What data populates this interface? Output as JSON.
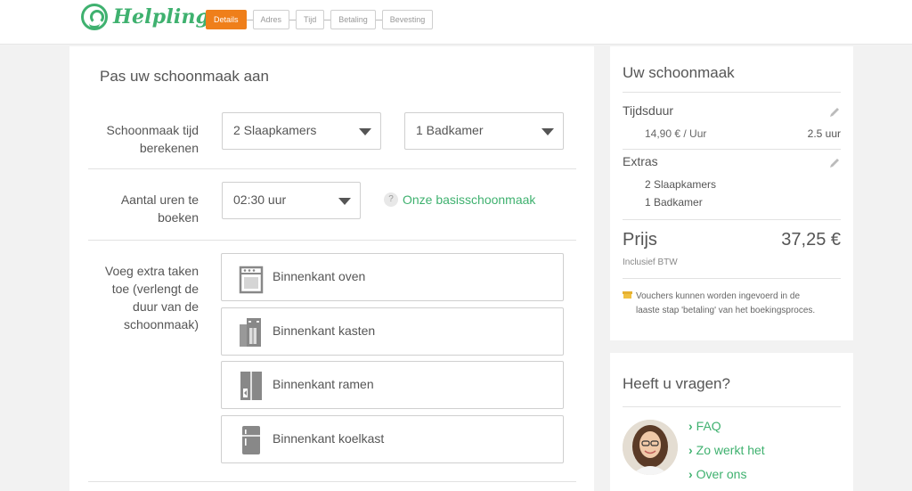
{
  "header": {
    "logo_text": "Helpling",
    "steps": [
      {
        "label": "Details",
        "active": true
      },
      {
        "label": "Adres",
        "active": false
      },
      {
        "label": "Tijd",
        "active": false
      },
      {
        "label": "Betaling",
        "active": false
      },
      {
        "label": "Bevesting",
        "active": false
      }
    ]
  },
  "main": {
    "title": "Pas uw schoonmaak aan",
    "calc_label_line1": "Schoonmaak tijd",
    "calc_label_line2": "berekenen",
    "bedrooms_select": "2 Slaapkamers",
    "bathrooms_select": "1 Badkamer",
    "hours_label_line1": "Aantal uren te",
    "hours_label_line2": "boeken",
    "hours_select": "02:30 uur",
    "info_icon": "?",
    "info_link": "Onze basisschoonmaak",
    "extra_label_line1": "Voeg extra taken",
    "extra_label_line2": "toe (verlengt de",
    "extra_label_line3": "duur van de",
    "extra_label_line4": "schoonmaak)",
    "tasks": [
      {
        "label": "Binnenkant oven",
        "icon": "oven-icon"
      },
      {
        "label": "Binnenkant kasten",
        "icon": "cabinet-icon"
      },
      {
        "label": "Binnenkant ramen",
        "icon": "window-icon"
      },
      {
        "label": "Binnenkant koelkast",
        "icon": "fridge-icon"
      }
    ]
  },
  "summary": {
    "title": "Uw schoonmaak",
    "duration_label": "Tijdsduur",
    "rate": "14,90 € / Uur",
    "duration_value": "2.5 uur",
    "extras_label": "Extras",
    "extras_items": [
      "2 Slaapkamers",
      "1 Badkamer"
    ],
    "price_label": "Prijs",
    "price_value": "37,25 €",
    "vat_note": "Inclusief BTW",
    "voucher_line1": "Vouchers kunnen worden ingevoerd in de",
    "voucher_line2": "laaste stap 'betaling' van het boekingsproces."
  },
  "help": {
    "title": "Heeft u vragen?",
    "links": [
      "FAQ",
      "Zo werkt het",
      "Over ons"
    ]
  },
  "colors": {
    "accent_green": "#3fb16f",
    "active_orange": "#ef7f1a"
  }
}
